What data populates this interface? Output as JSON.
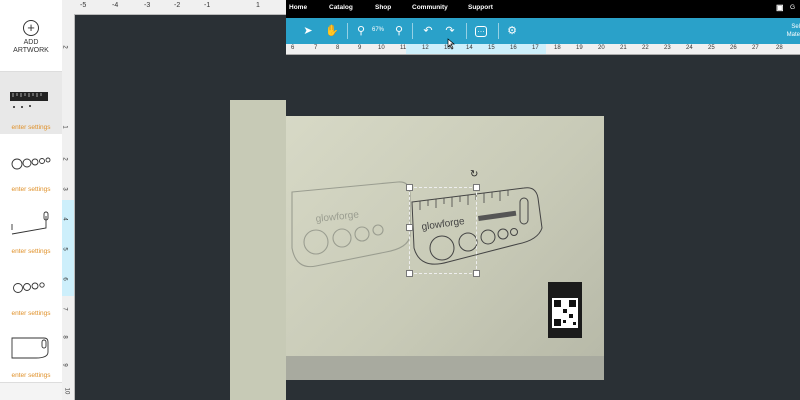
{
  "sidebar": {
    "add_artwork": "ADD\nARTWORK",
    "items": [
      {
        "label": "enter settings",
        "icon": "ruler-thumbnail-icon"
      },
      {
        "label": "enter settings",
        "icon": "circles-thumbnail-icon"
      },
      {
        "label": "enter settings",
        "icon": "outline-thumbnail-icon"
      },
      {
        "label": "enter settings",
        "icon": "circles-small-thumbnail-icon"
      },
      {
        "label": "enter settings",
        "icon": "shape-thumbnail-icon"
      }
    ]
  },
  "top_ruler": {
    "ticks": [
      "-5",
      "-4",
      "-3",
      "-2",
      "-1",
      "1"
    ]
  },
  "vertical_ruler": {
    "ticks": [
      "2",
      "1",
      "2",
      "3",
      "4",
      "5",
      "6",
      "7",
      "8",
      "9",
      "10"
    ]
  },
  "nav": {
    "items": [
      "Home",
      "Catalog",
      "Shop",
      "Community",
      "Support"
    ]
  },
  "toolbar": {
    "zoom_label": "67%",
    "right_text": "Sel\nMate",
    "user_initial": "G"
  },
  "ruler2": {
    "ticks": [
      "6",
      "7",
      "8",
      "9",
      "10",
      "11",
      "12",
      "13",
      "14",
      "15",
      "16",
      "17",
      "18",
      "19",
      "20",
      "21",
      "22",
      "23",
      "24",
      "25",
      "26",
      "27",
      "28"
    ]
  },
  "artwork": {
    "brand": "glowforge"
  }
}
